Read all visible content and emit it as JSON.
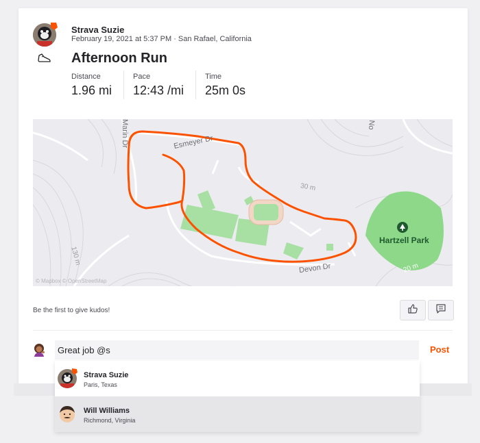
{
  "athlete": {
    "name": "Strava Suzie",
    "date_location": "February 19, 2021 at 5:37 PM · San Rafael, California"
  },
  "activity": {
    "title": "Afternoon Run",
    "stats": [
      {
        "label": "Distance",
        "value": "1.96 mi"
      },
      {
        "label": "Pace",
        "value": "12:43 /mi"
      },
      {
        "label": "Time",
        "value": "25m 0s"
      }
    ]
  },
  "map": {
    "street_labels": [
      "Marin Dr",
      "Esmeyer Dr",
      "Devon Dr",
      "No"
    ],
    "contour_labels": [
      "30 m",
      "130 m",
      "20 m"
    ],
    "park_name": "Hartzell Park",
    "attribution": "© Mapbox © OpenStreetMap",
    "route_color": "#fc5200",
    "park_color": "#8ed88a"
  },
  "social": {
    "kudos_prompt": "Be the first to give kudos!",
    "kudos_icon": "thumbs-up-icon",
    "comment_icon": "comment-icon"
  },
  "comment": {
    "input_value": "Great job @s",
    "post_label": "Post"
  },
  "mentions": [
    {
      "name": "Strava Suzie",
      "location": "Paris, Texas"
    },
    {
      "name": "Will Williams",
      "location": "Richmond, Virginia"
    }
  ],
  "colors": {
    "brand": "#fc5200",
    "text": "#242428",
    "muted": "#494950"
  }
}
